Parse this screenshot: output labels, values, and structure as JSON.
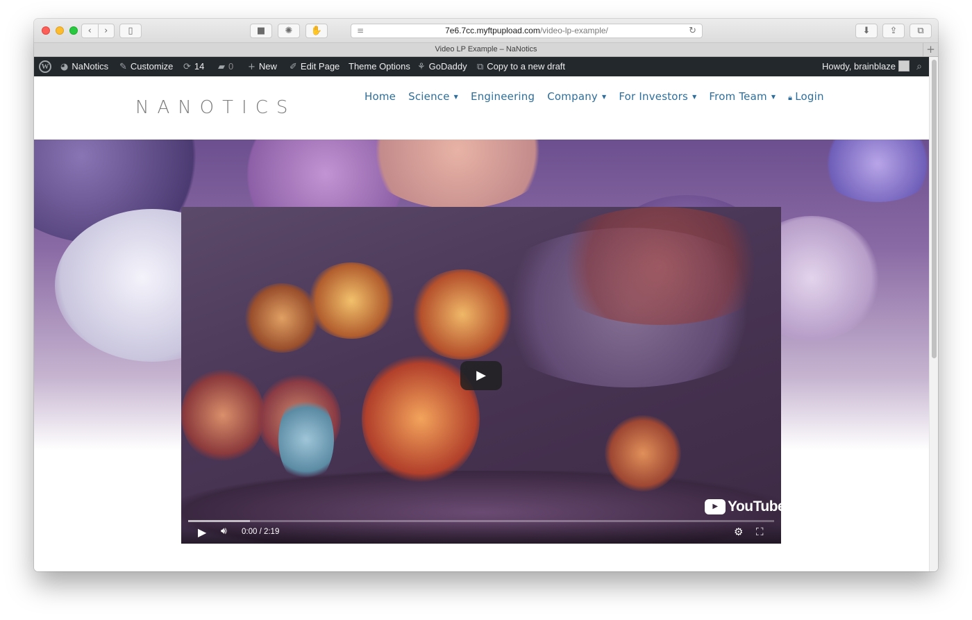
{
  "browser": {
    "url_host": "7e6.7cc.myftpupload.com",
    "url_path": "/video-lp-example/",
    "tab_title": "Video LP Example – NaNotics"
  },
  "admin_bar": {
    "site_name": "NaNotics",
    "customize": "Customize",
    "updates_count": "14",
    "comments_count": "0",
    "new": "New",
    "edit_page": "Edit Page",
    "theme_options": "Theme Options",
    "godaddy": "GoDaddy",
    "copy_draft": "Copy to a new draft",
    "howdy": "Howdy, brainblaze"
  },
  "site": {
    "logo": "NANOTICS",
    "nav": {
      "home": "Home",
      "science": "Science",
      "engineering": "Engineering",
      "company": "Company",
      "investors": "For Investors",
      "team": "From Team",
      "login": "Login"
    }
  },
  "video": {
    "time": "0:00 / 2:19",
    "buffered_fraction": 0.105,
    "brand": "YouTube"
  },
  "colors": {
    "nav_link": "#2d6e9c",
    "admin_bar": "#23282d"
  }
}
